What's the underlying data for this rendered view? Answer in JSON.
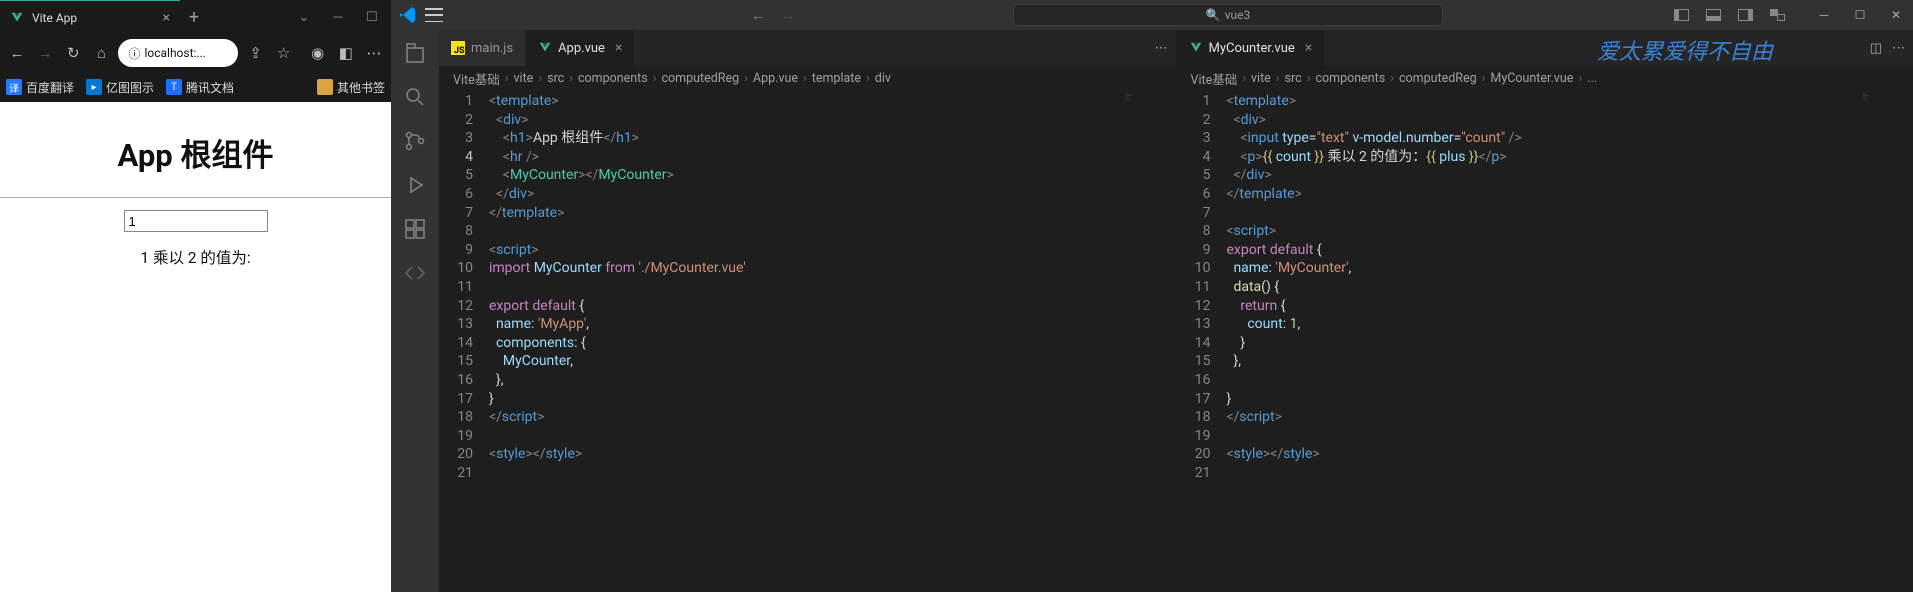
{
  "browser": {
    "tab_title": "Vite App",
    "address": "localhost:...",
    "bookmarks": [
      {
        "label": "百度翻译",
        "color": "#2878ff"
      },
      {
        "label": "亿图图示",
        "color": "#0078d4"
      },
      {
        "label": "腾讯文档",
        "color": "#1e6fff"
      }
    ],
    "other_bm": "其他书签",
    "page": {
      "h1": "App 根组件",
      "input_value": "1",
      "result_text": "1 乘以 2 的值为:"
    }
  },
  "vscode": {
    "search_value": "vue3",
    "nav_back": "←",
    "nav_fwd": "→",
    "watermark": "爱太累爱得不自由",
    "editor1": {
      "tabs": [
        {
          "name": "main.js",
          "icon": "js",
          "active": false,
          "close": false
        },
        {
          "name": "App.vue",
          "icon": "vue",
          "active": true,
          "close": true
        }
      ],
      "breadcrumb": [
        "Vite基础",
        "vite",
        "src",
        "components",
        "computedReg",
        "App.vue",
        "template",
        "div"
      ],
      "code_lines": [
        {
          "n": 1,
          "html": "<span class='t-pun'>&lt;</span><span class='t-tag'>template</span><span class='t-pun'>&gt;</span>"
        },
        {
          "n": 2,
          "html": "  <span class='t-pun'>&lt;</span><span class='t-tag'>div</span><span class='t-pun'>&gt;</span>"
        },
        {
          "n": 3,
          "html": "    <span class='t-pun'>&lt;</span><span class='t-tag'>h1</span><span class='t-pun'>&gt;</span><span class='t-txt'>App 根组件</span><span class='t-pun'>&lt;/</span><span class='t-tag'>h1</span><span class='t-pun'>&gt;</span>"
        },
        {
          "n": 4,
          "html": "    <span class='t-pun'>&lt;</span><span class='t-tag'>hr</span> <span class='t-pun'>/&gt;</span>",
          "cur": true
        },
        {
          "n": 5,
          "html": "    <span class='t-pun'>&lt;</span><span class='t-el'>MyCounter</span><span class='t-pun'>&gt;&lt;/</span><span class='t-el'>MyCounter</span><span class='t-pun'>&gt;</span>"
        },
        {
          "n": 6,
          "html": "  <span class='t-pun'>&lt;/</span><span class='t-tag'>div</span><span class='t-pun'>&gt;</span>"
        },
        {
          "n": 7,
          "html": "<span class='t-pun'>&lt;/</span><span class='t-tag'>template</span><span class='t-pun'>&gt;</span>"
        },
        {
          "n": 8,
          "html": ""
        },
        {
          "n": 9,
          "html": "<span class='t-pun'>&lt;</span><span class='t-tag'>script</span><span class='t-pun'>&gt;</span>"
        },
        {
          "n": 10,
          "html": "<span class='t-kw'>import</span> <span class='t-var'>MyCounter</span> <span class='t-kw'>from</span> <span class='t-str'>'./MyCounter.vue'</span>"
        },
        {
          "n": 11,
          "html": ""
        },
        {
          "n": 12,
          "html": "<span class='t-kw'>export</span> <span class='t-kw'>default</span> <span class='t-txt'>{</span>"
        },
        {
          "n": 13,
          "html": "  <span class='t-var'>name</span><span class='t-txt'>:</span> <span class='t-str'>'MyApp'</span><span class='t-txt'>,</span>"
        },
        {
          "n": 14,
          "html": "  <span class='t-var'>components</span><span class='t-txt'>: {</span>"
        },
        {
          "n": 15,
          "html": "    <span class='t-var'>MyCounter</span><span class='t-txt'>,</span>"
        },
        {
          "n": 16,
          "html": "  <span class='t-txt'>},</span>"
        },
        {
          "n": 17,
          "html": "<span class='t-txt'>}</span>"
        },
        {
          "n": 18,
          "html": "<span class='t-pun'>&lt;/</span><span class='t-tag'>script</span><span class='t-pun'>&gt;</span>"
        },
        {
          "n": 19,
          "html": ""
        },
        {
          "n": 20,
          "html": "<span class='t-pun'>&lt;</span><span class='t-tag'>style</span><span class='t-pun'>&gt;&lt;/</span><span class='t-tag'>style</span><span class='t-pun'>&gt;</span>"
        },
        {
          "n": 21,
          "html": ""
        }
      ]
    },
    "editor2": {
      "tabs": [
        {
          "name": "MyCounter.vue",
          "icon": "vue",
          "active": true,
          "close": true
        }
      ],
      "breadcrumb": [
        "Vite基础",
        "vite",
        "src",
        "components",
        "computedReg",
        "MyCounter.vue",
        "..."
      ],
      "code_lines": [
        {
          "n": 1,
          "html": "<span class='t-pun'>&lt;</span><span class='t-tag'>template</span><span class='t-pun'>&gt;</span>"
        },
        {
          "n": 2,
          "html": "  <span class='t-pun'>&lt;</span><span class='t-tag'>div</span><span class='t-pun'>&gt;</span>"
        },
        {
          "n": 3,
          "html": "    <span class='t-pun'>&lt;</span><span class='t-tag'>input</span> <span class='t-attr'>type</span><span class='t-txt'>=</span><span class='t-str'>\"text\"</span> <span class='t-attr'>v-model</span><span class='t-txt'>.</span><span class='t-attr'>number</span><span class='t-txt'>=</span><span class='t-str'>\"count\"</span> <span class='t-pun'>/&gt;</span>"
        },
        {
          "n": 4,
          "html": "    <span class='t-pun'>&lt;</span><span class='t-tag'>p</span><span class='t-pun'>&gt;</span><span class='t-mus'>{{</span> <span class='t-var'>count</span> <span class='t-mus'>}}</span><span class='t-txt'> 乘以 2 的值为：</span><span class='t-mus'>{{</span> <span class='t-var'>plus</span> <span class='t-mus'>}}</span><span class='t-pun'>&lt;/</span><span class='t-tag'>p</span><span class='t-pun'>&gt;</span>"
        },
        {
          "n": 5,
          "html": "  <span class='t-pun'>&lt;/</span><span class='t-tag'>div</span><span class='t-pun'>&gt;</span>"
        },
        {
          "n": 6,
          "html": "<span class='t-pun'>&lt;/</span><span class='t-tag'>template</span><span class='t-pun'>&gt;</span>"
        },
        {
          "n": 7,
          "html": ""
        },
        {
          "n": 8,
          "html": "<span class='t-pun'>&lt;</span><span class='t-tag'>script</span><span class='t-pun'>&gt;</span>"
        },
        {
          "n": 9,
          "html": "<span class='t-kw'>export</span> <span class='t-kw'>default</span> <span class='t-txt'>{</span>"
        },
        {
          "n": 10,
          "html": "  <span class='t-var'>name</span><span class='t-txt'>:</span> <span class='t-str'>'MyCounter'</span><span class='t-txt'>,</span>"
        },
        {
          "n": 11,
          "html": "  <span class='t-fn'>data</span><span class='t-txt'>() {</span>"
        },
        {
          "n": 12,
          "html": "    <span class='t-kw'>return</span> <span class='t-txt'>{</span>"
        },
        {
          "n": 13,
          "html": "      <span class='t-var'>count</span><span class='t-txt'>:</span> <span class='t-num'>1</span><span class='t-txt'>,</span>"
        },
        {
          "n": 14,
          "html": "    <span class='t-txt'>}</span>"
        },
        {
          "n": 15,
          "html": "  <span class='t-txt'>},</span>"
        },
        {
          "n": 16,
          "html": ""
        },
        {
          "n": 17,
          "html": "<span class='t-txt'>}</span>"
        },
        {
          "n": 18,
          "html": "<span class='t-pun'>&lt;/</span><span class='t-tag'>script</span><span class='t-pun'>&gt;</span>"
        },
        {
          "n": 19,
          "html": ""
        },
        {
          "n": 20,
          "html": "<span class='t-pun'>&lt;</span><span class='t-tag'>style</span><span class='t-pun'>&gt;&lt;/</span><span class='t-tag'>style</span><span class='t-pun'>&gt;</span>"
        },
        {
          "n": 21,
          "html": ""
        }
      ]
    }
  }
}
